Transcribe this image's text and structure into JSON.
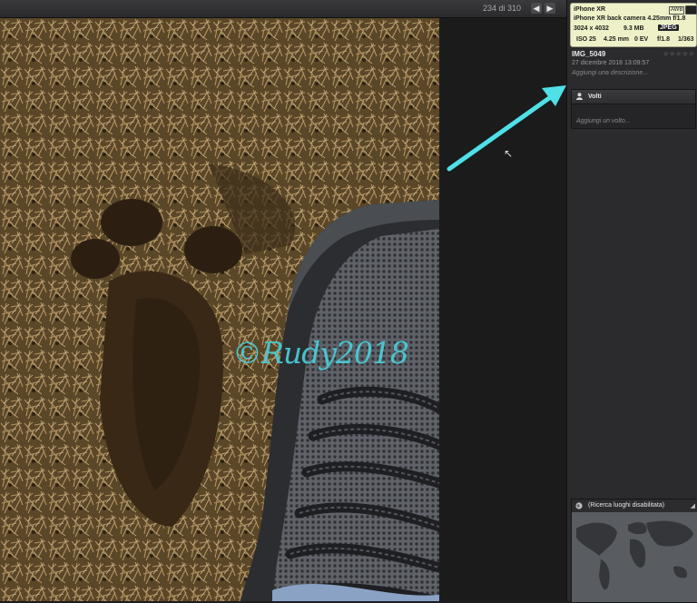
{
  "toolbar": {
    "counter": "234 di 310",
    "prev_icon": "arrow-left-icon",
    "next_icon": "arrow-right-icon"
  },
  "photo": {
    "watermark": "©Rudy2018",
    "colors": {
      "watermark": "#49d1dc",
      "arrow": "#4fe0e8"
    }
  },
  "exif": {
    "camera": "iPhone XR",
    "awb": "AWB",
    "lens": "iPhone XR back camera 4.25mm f/1.8",
    "resolution": "3024 x 4032",
    "size": "9.3 MB",
    "format": "JPEG",
    "iso": "ISO 25",
    "focal": "4.25 mm",
    "ev": "0 EV",
    "aperture": "f/1.8",
    "shutter": "1/363"
  },
  "info": {
    "title": "IMG_5049",
    "date": "27 dicembre 2018 13:09:57",
    "description_placeholder": "Aggiungi una descrizione...",
    "rating_stars": 0
  },
  "faces": {
    "label": "Volti",
    "add_placeholder": "Aggiungi un volto..."
  },
  "places": {
    "label": "(Ricerca luoghi disabilitata)"
  }
}
